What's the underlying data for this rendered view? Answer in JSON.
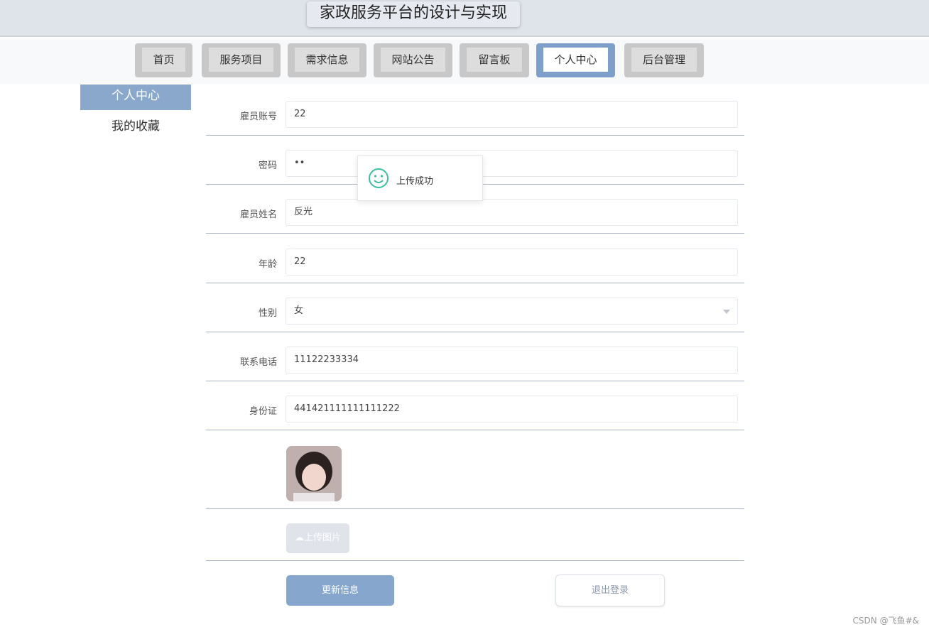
{
  "header": {
    "title": "家政服务平台的设计与实现"
  },
  "nav": {
    "tabs": [
      {
        "label": "首页"
      },
      {
        "label": "服务项目"
      },
      {
        "label": "需求信息"
      },
      {
        "label": "网站公告"
      },
      {
        "label": "留言板"
      },
      {
        "label": "个人中心",
        "active": true
      },
      {
        "label": "后台管理"
      }
    ]
  },
  "sidebar": {
    "items": [
      {
        "label": "个人中心",
        "active": true
      },
      {
        "label": "我的收藏"
      }
    ]
  },
  "form": {
    "fields": [
      {
        "label": "雇员账号",
        "value": "22"
      },
      {
        "label": "密码",
        "value": "••"
      },
      {
        "label": "雇员姓名",
        "value": "反光"
      },
      {
        "label": "年龄",
        "value": "22"
      },
      {
        "label": "性别",
        "value": "女"
      },
      {
        "label": "联系电话",
        "value": "11122233334"
      },
      {
        "label": "身份证",
        "value": "441421111111111222"
      }
    ],
    "upload_label": "上传图片",
    "update_label": "更新信息",
    "logout_label": "退出登录"
  },
  "toast": {
    "message": "上传成功",
    "icon": "smile-icon"
  },
  "watermark": "CSDN @飞鱼#&",
  "colors": {
    "accent": "#86a6ce"
  }
}
